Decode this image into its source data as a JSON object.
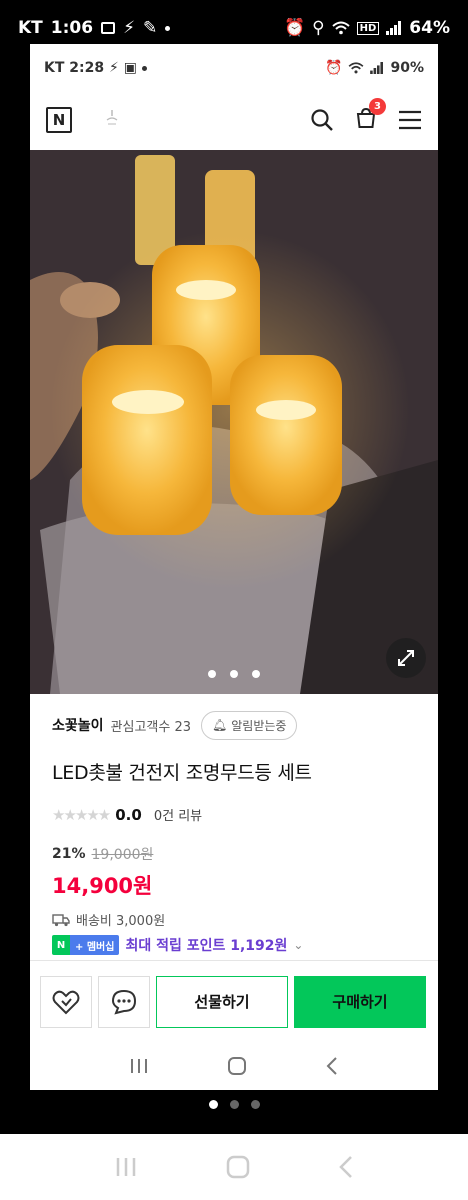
{
  "outer_status": {
    "carrier": "KT",
    "time": "1:06",
    "battery": "64%"
  },
  "inner_status": {
    "carrier": "KT",
    "time": "2:28",
    "battery": "90%"
  },
  "header": {
    "logo": "N",
    "cart_count": "3"
  },
  "gallery": {
    "page_count": 3,
    "active_index": 0
  },
  "product": {
    "store_name": "소꽃놀이",
    "fav_label": "관심고객수 23",
    "alarm_label": "알림받는중",
    "title": "LED촛불 건전지 조명무드등 세트",
    "rating": "0.0",
    "review_label": "0건 리뷰",
    "rating_stars": 0,
    "discount": "21%",
    "original_price": "19,000원",
    "price": "14,900원",
    "shipping": "배송비 3,000원",
    "member_badge_n": "N",
    "member_badge_label": "+ 멤버십",
    "points": "최대 적립 포인트 1,192원"
  },
  "actions": {
    "gift_label": "선물하기",
    "buy_label": "구매하기"
  },
  "colors": {
    "brand_green": "#03c75a",
    "price_red": "#f4003c",
    "points_purple": "#6a3ed1",
    "badge_red": "#f43a3a"
  }
}
